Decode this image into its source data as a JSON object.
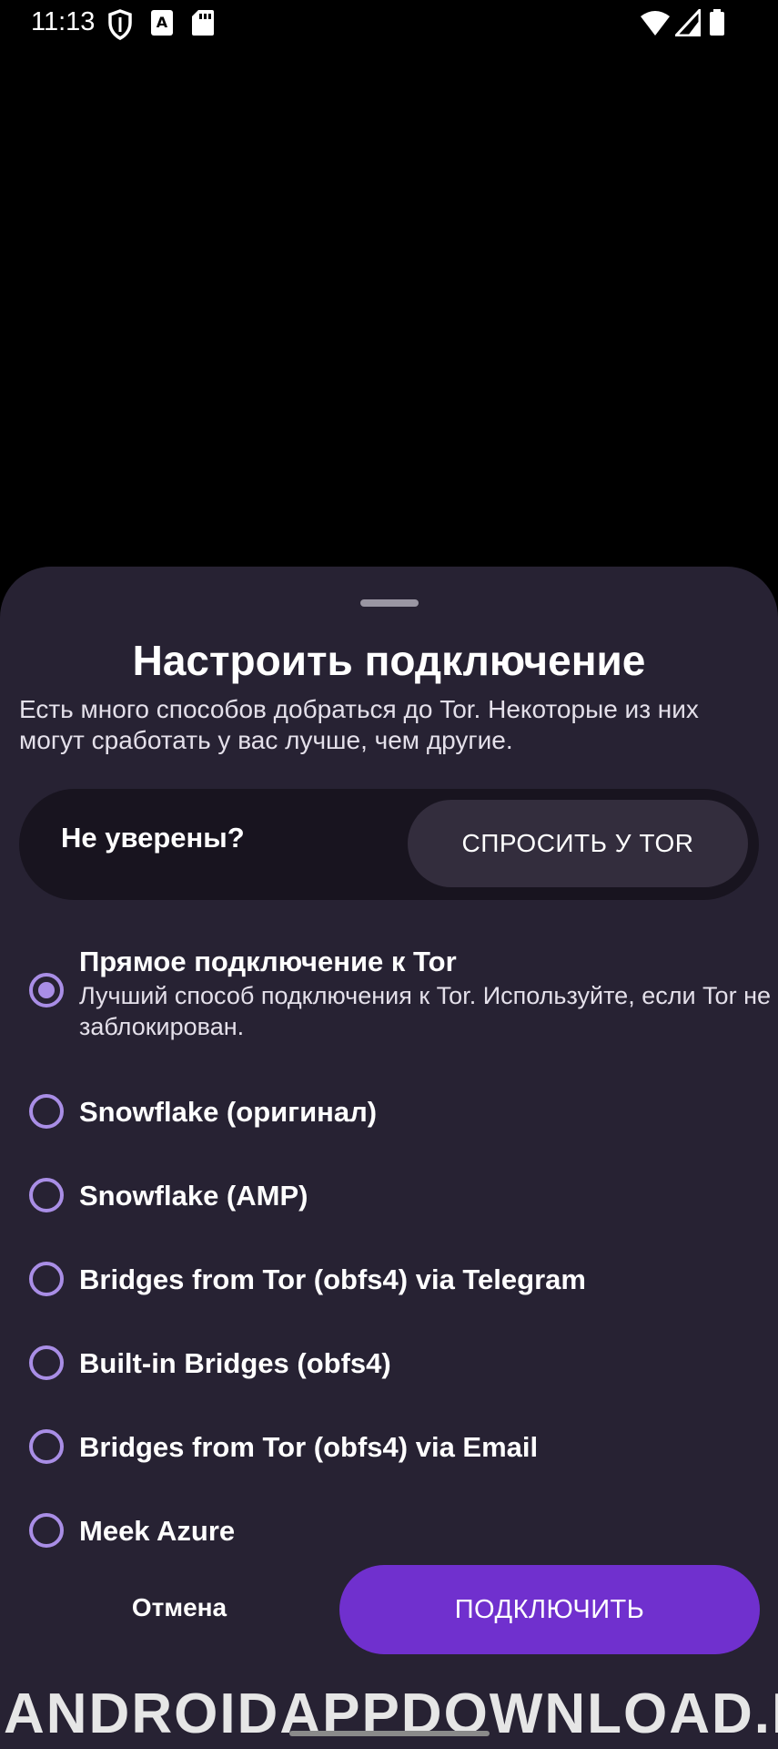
{
  "status_bar": {
    "time": "11:13",
    "icons_left": [
      "shield-icon",
      "font-a-icon",
      "sd-card-icon"
    ],
    "icons_right": [
      "wifi-icon",
      "signal-icon",
      "battery-icon"
    ]
  },
  "sheet": {
    "title": "Настроить подключение",
    "description": "Есть много способов добраться до Tor. Некоторые из них могут сработать у вас лучше, чем другие.",
    "ask": {
      "label": "Не уверены?",
      "button": "СПРОСИТЬ У TOR"
    },
    "options": [
      {
        "label": "Прямое подключение к Tor",
        "sublabel": "Лучший способ подключения к Tor. Используйте, если Tor не заблокирован.",
        "selected": true
      },
      {
        "label": "Snowflake (оригинал)",
        "selected": false
      },
      {
        "label": "Snowflake (AMP)",
        "selected": false
      },
      {
        "label": "Bridges from Tor (obfs4) via Telegram",
        "selected": false
      },
      {
        "label": "Built-in Bridges (obfs4)",
        "selected": false
      },
      {
        "label": "Bridges from Tor (obfs4) via Email",
        "selected": false
      },
      {
        "label": "Meek Azure",
        "selected": false
      }
    ],
    "cancel_label": "Отмена",
    "connect_label": "ПОДКЛЮЧИТЬ"
  },
  "watermark": "ANDROIDAPPDOWNLOAD.L",
  "colors": {
    "accent": "#7030ce",
    "radio": "#a98ee6",
    "sheet_bg": "#272233",
    "ask_box_bg": "#18141f",
    "ask_button_bg": "#332d3d"
  }
}
